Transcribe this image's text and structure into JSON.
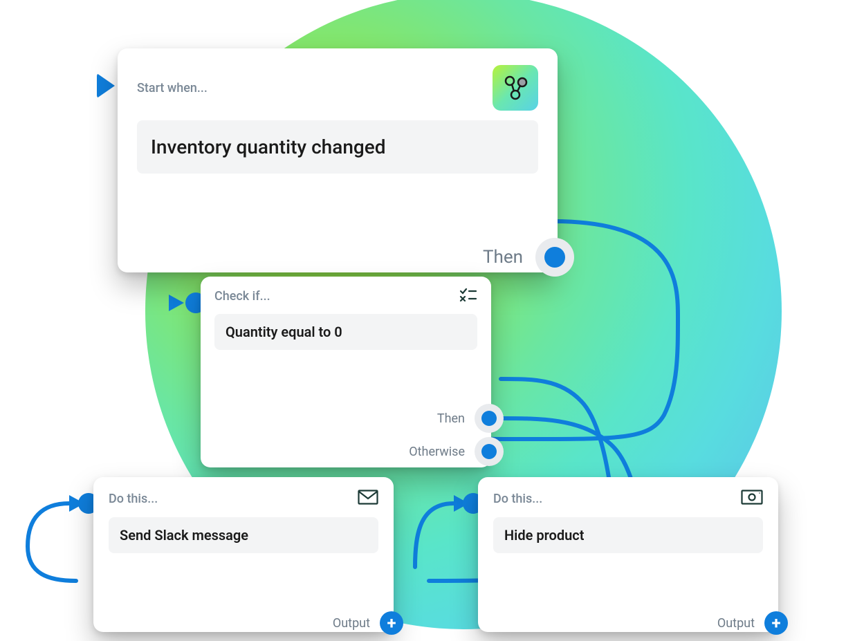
{
  "colors": {
    "accent": "#0f7edc"
  },
  "trigger": {
    "header": "Start when...",
    "content": "Inventory quantity changed",
    "out_label": "Then",
    "app_icon": "flow-app-icon"
  },
  "condition": {
    "header": "Check if...",
    "content": "Quantity equal to 0",
    "out_then": "Then",
    "out_else": "Otherwise",
    "icon": "condition-icon"
  },
  "action_a": {
    "header": "Do this...",
    "content": "Send Slack message",
    "out_label": "Output",
    "icon": "envelope-icon"
  },
  "action_b": {
    "header": "Do this...",
    "content": "Hide product",
    "out_label": "Output",
    "icon": "cash-icon"
  }
}
